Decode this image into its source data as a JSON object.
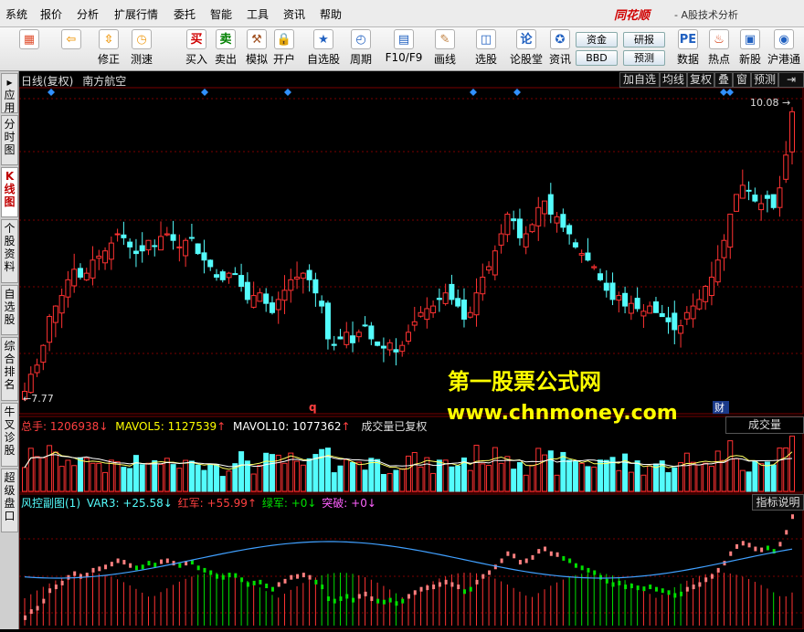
{
  "menu": [
    "系统",
    "报价",
    "分析",
    "扩展行情",
    "委托",
    "智能",
    "工具",
    "资讯",
    "帮助"
  ],
  "brand": {
    "name": "同花顺",
    "subtitle": "- A股技术分析"
  },
  "toolbar": {
    "items": [
      {
        "label": "",
        "icon": "app-grid-icon",
        "color": "#e05030"
      },
      {
        "label": "",
        "icon": "back-arrow-icon",
        "color": "#f0a020"
      },
      {
        "label": "修正",
        "icon": "up-down-arrows-icon",
        "color": "#f0a020"
      },
      {
        "label": "测速",
        "icon": "clock-icon",
        "color": "#f0a020"
      },
      {
        "label": "买入",
        "icon": "buy-icon",
        "glyph": "买",
        "color": "#d00000"
      },
      {
        "label": "卖出",
        "icon": "sell-icon",
        "glyph": "卖",
        "color": "#008000"
      },
      {
        "label": "模拟",
        "icon": "hammer-icon",
        "color": "#a05020"
      },
      {
        "label": "开户",
        "icon": "lock-icon",
        "color": "#c08020"
      },
      {
        "label": "自选股",
        "icon": "star-folder-icon",
        "color": "#2060c0"
      },
      {
        "label": "周期",
        "icon": "cycle-icon",
        "color": "#2060c0"
      },
      {
        "label": "F10/F9",
        "icon": "f10-icon",
        "color": "#2060c0"
      },
      {
        "label": "画线",
        "icon": "pencil-icon",
        "color": "#c08040"
      },
      {
        "label": "选股",
        "icon": "stock-select-icon",
        "color": "#2060c0"
      },
      {
        "label": "论股堂",
        "icon": "forum-icon",
        "glyph": "论",
        "color": "#2060c0"
      },
      {
        "label": "资讯",
        "icon": "news-icon",
        "color": "#2060c0"
      },
      {
        "label": "数据",
        "icon": "pe-data-icon",
        "glyph": "PE",
        "color": "#2060c0"
      },
      {
        "label": "热点",
        "icon": "hot-icon",
        "color": "#d03000"
      },
      {
        "label": "新股",
        "icon": "new-stock-icon",
        "color": "#2060c0"
      },
      {
        "label": "沪港通",
        "icon": "sse-hk-icon",
        "color": "#2060c0"
      }
    ],
    "small_buttons": [
      "资金",
      "研报",
      "BBD",
      "预测"
    ]
  },
  "side_tabs": [
    {
      "label": "应用",
      "active": false
    },
    {
      "label": "分时图",
      "active": false
    },
    {
      "label": "K线图",
      "active": true
    },
    {
      "label": "个股资料",
      "active": false
    },
    {
      "label": "自选股",
      "active": false
    },
    {
      "label": "综合排名",
      "active": false
    },
    {
      "label": "牛叉诊股",
      "active": false
    },
    {
      "label": "超级盘口",
      "active": false
    }
  ],
  "chart_header": {
    "period": "日线(复权)",
    "stock_name": "南方航空"
  },
  "right_buttons": [
    "加自选",
    "均线",
    "复权",
    "叠",
    "窗",
    "预测"
  ],
  "price_panel": {
    "high_label": "10.08",
    "low_label": "7.77",
    "marker_q": "q",
    "marker_cai": "财"
  },
  "volume_panel": {
    "total_label": "总手:",
    "total_value": "1206938",
    "mavol5_label": "MAVOL5:",
    "mavol5_value": "1127539",
    "mavol10_label": "MAVOL10:",
    "mavol10_value": "1077362",
    "note": "成交量已复权",
    "dropdown": "成交量"
  },
  "indicator_panel": {
    "name": "风控副图(1)",
    "var3_label": "VAR3:",
    "var3_value": "+25.58",
    "red_label": "红军:",
    "red_value": "+55.99",
    "green_label": "绿军:",
    "green_value": "+0",
    "break_label": "突破:",
    "break_value": "+0",
    "button": "指标说明"
  },
  "watermark": {
    "line1": "第一股票公式网",
    "line2": "www.chnmoney.com"
  },
  "colors": {
    "up": "#ff3232",
    "down": "#54fcfc",
    "yellow": "#ffff00",
    "grid": "#7a0000",
    "green": "#00e000"
  },
  "chart_data": {
    "type": "candlestick",
    "price_min": 7.77,
    "price_max": 10.08,
    "close": [
      7.85,
      7.98,
      8.05,
      8.2,
      8.42,
      8.5,
      8.58,
      8.7,
      8.78,
      8.72,
      8.75,
      8.85,
      8.88,
      8.92,
      8.98,
      9.05,
      9.02,
      8.95,
      8.9,
      8.92,
      9.0,
      8.96,
      9.03,
      9.05,
      9.0,
      8.95,
      9.0,
      9.02,
      8.9,
      8.85,
      8.8,
      8.72,
      8.7,
      8.75,
      8.74,
      8.65,
      8.55,
      8.58,
      8.6,
      8.52,
      8.45,
      8.55,
      8.62,
      8.7,
      8.72,
      8.75,
      8.7,
      8.6,
      8.5,
      8.25,
      8.2,
      8.25,
      8.3,
      8.22,
      8.3,
      8.35,
      8.25,
      8.2,
      8.18,
      8.22,
      8.15,
      8.2,
      8.3,
      8.38,
      8.45,
      8.48,
      8.5,
      8.55,
      8.6,
      8.55,
      8.5,
      8.4,
      8.45,
      8.6,
      8.72,
      8.8,
      8.92,
      9.05,
      9.2,
      9.15,
      9.02,
      9.05,
      9.12,
      9.25,
      9.3,
      9.2,
      9.18,
      9.1,
      9.05,
      8.95,
      8.9,
      8.85,
      8.8,
      8.7,
      8.62,
      8.55,
      8.58,
      8.5,
      8.52,
      8.48,
      8.46,
      8.5,
      8.45,
      8.42,
      8.38,
      8.32,
      8.35,
      8.45,
      8.5,
      8.55,
      8.65,
      8.72,
      8.85,
      9.0,
      9.2,
      9.35,
      9.42,
      9.38,
      9.3,
      9.28,
      9.32,
      9.25,
      9.4,
      9.65,
      9.98
    ]
  }
}
